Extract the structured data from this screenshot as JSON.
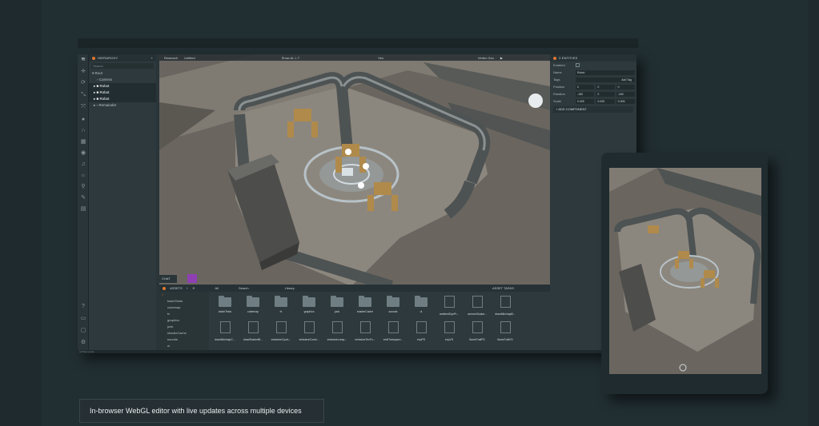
{
  "hierarchy": {
    "title": "HIERARCHY",
    "search_placeholder": "Search",
    "items": [
      {
        "label": "Root",
        "depth": 0,
        "selected": false
      },
      {
        "label": "Camera",
        "depth": 1,
        "selected": false
      },
      {
        "label": "Robot",
        "depth": 1,
        "selected": true
      },
      {
        "label": "Robot",
        "depth": 1,
        "selected": true
      },
      {
        "label": "Robot",
        "depth": 1,
        "selected": true
      },
      {
        "label": "Remainder",
        "depth": 1,
        "selected": false
      }
    ]
  },
  "viewport": {
    "tabs": [
      "Research",
      "Untitled",
      "Show AL L.T",
      "Ves",
      "Vertex Geo"
    ]
  },
  "inspector": {
    "title": "3 ENTITIES",
    "rows": {
      "enabled_label": "Enabled",
      "name_label": "Name",
      "name_value": "Robot",
      "tags_label": "Tags",
      "tags_value": "Add Tag",
      "position_label": "Position",
      "position_values": [
        "0",
        "0",
        "0"
      ],
      "rotation_label": "Rotation",
      "rotation_values": [
        "-180",
        "0",
        "-180"
      ],
      "scale_label": "Scale",
      "scale_values": [
        "0.005",
        "0.005",
        "0.005"
      ]
    },
    "add_component": "ADD COMPONENT"
  },
  "chat": {
    "label": "CHAT"
  },
  "assets": {
    "title": "ASSETS",
    "filter": "All",
    "search_placeholder": "Search",
    "library_label": "Library",
    "tasks_title": "ASSET TASKS",
    "tree": [
      "/",
      "batchTests",
      "cubemap",
      "fx",
      "graphics",
      "junk",
      "shaderCache",
      "sounds",
      "ui"
    ],
    "row1": [
      {
        "label": "batchTests",
        "kind": "folder"
      },
      {
        "label": "cubemap",
        "kind": "folder"
      },
      {
        "label": "fx",
        "kind": "folder"
      },
      {
        "label": "graphics",
        "kind": "folder"
      },
      {
        "label": "junk",
        "kind": "folder"
      },
      {
        "label": "shaderCache",
        "kind": "folder"
      },
      {
        "label": "sounds",
        "kind": "folder"
      },
      {
        "label": "ui",
        "kind": "folder"
      },
      {
        "label": "ambientDynPr...",
        "kind": "file"
      },
      {
        "label": "ammonScalar...",
        "kind": "file"
      },
      {
        "label": "drawMinimapB...",
        "kind": "file"
      }
    ],
    "row2": [
      {
        "label": "drawMinimapC...",
        "kind": "file"
      },
      {
        "label": "drawShadedB...",
        "kind": "file"
      },
      {
        "label": "emissiveCyclo...",
        "kind": "file"
      },
      {
        "label": "emissiveConst...",
        "kind": "file"
      },
      {
        "label": "emissiveLamp...",
        "kind": "file"
      },
      {
        "label": "emissiveTexFo...",
        "kind": "file"
      },
      {
        "label": "emitTranspare...",
        "kind": "file"
      },
      {
        "label": "expPS",
        "kind": "file"
      },
      {
        "label": "expVS",
        "kind": "file"
      },
      {
        "label": "flameTrailPS",
        "kind": "file"
      },
      {
        "label": "flameTrailVS",
        "kind": "file"
      }
    ]
  },
  "status_bar": "architex.poste",
  "caption": "In-browser WebGL editor with live updates across multiple devices",
  "colors": {
    "accent": "#e3772e",
    "background": "#1e2a2e",
    "panel": "#2d393d"
  }
}
